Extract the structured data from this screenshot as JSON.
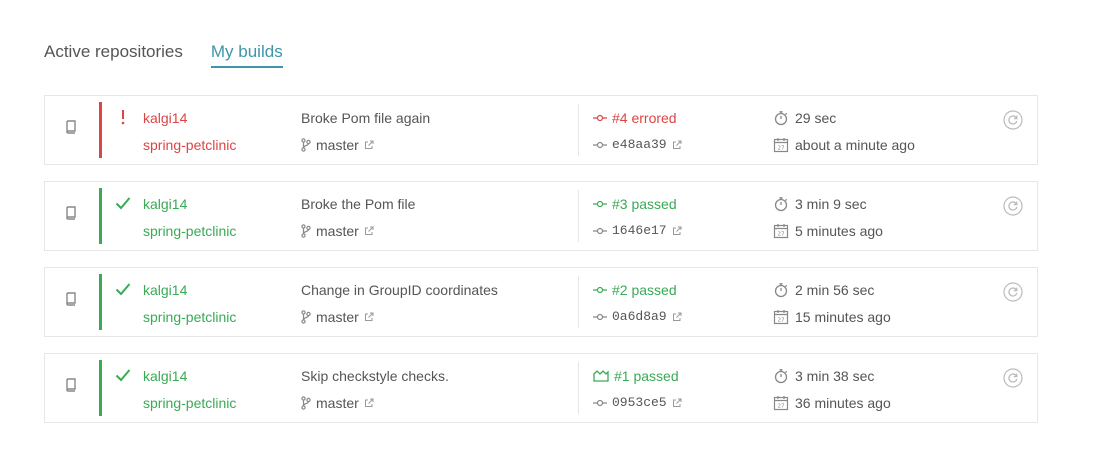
{
  "tabs": {
    "active_repositories": "Active repositories",
    "my_builds": "My builds"
  },
  "colors": {
    "errored": "#db4545",
    "passed": "#39aa56",
    "accent": "#3e96a8"
  },
  "builds": [
    {
      "state": "errored",
      "owner": "kalgi14",
      "repo": "spring-petclinic",
      "message": "Broke Pom file again",
      "branch": "master",
      "build": "#4 errored",
      "commit": "e48aa39",
      "duration": "29 sec",
      "finished": "about a minute ago"
    },
    {
      "state": "passed",
      "owner": "kalgi14",
      "repo": "spring-petclinic",
      "message": "Broke the Pom file",
      "branch": "master",
      "build": "#3 passed",
      "commit": "1646e17",
      "duration": "3 min 9 sec",
      "finished": "5 minutes ago"
    },
    {
      "state": "passed",
      "owner": "kalgi14",
      "repo": "spring-petclinic",
      "message": "Change in GroupID coordinates",
      "branch": "master",
      "build": "#2 passed",
      "commit": "0a6d8a9",
      "duration": "2 min 56 sec",
      "finished": "15 minutes ago"
    },
    {
      "state": "passed",
      "owner": "kalgi14",
      "repo": "spring-petclinic",
      "message": "Skip checkstyle checks.",
      "branch": "master",
      "build": "#1 passed",
      "commit": "0953ce5",
      "duration": "3 min 38 sec",
      "finished": "36 minutes ago"
    }
  ]
}
